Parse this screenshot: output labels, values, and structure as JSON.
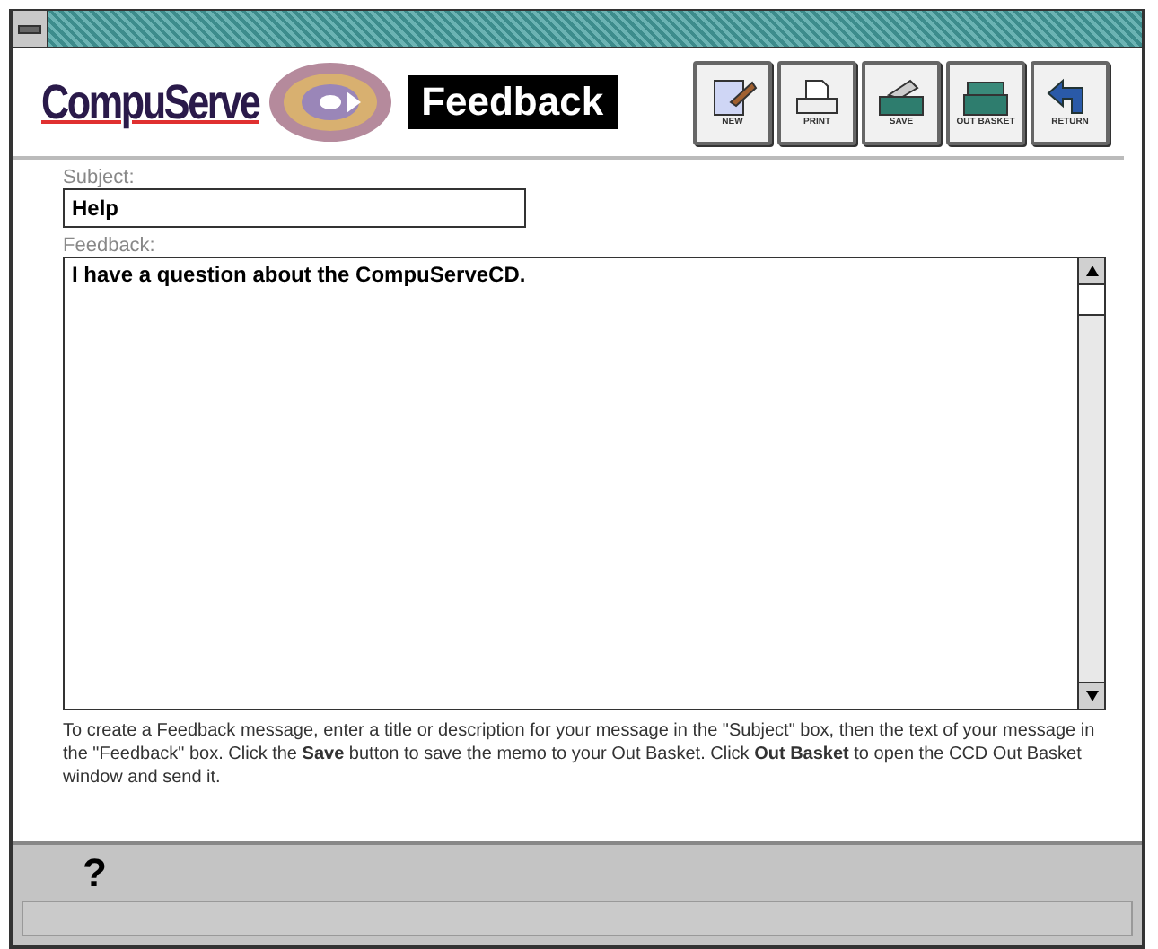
{
  "header": {
    "logo": "CompuServe",
    "title": "Feedback"
  },
  "toolbar": [
    {
      "kind": "new",
      "label": "NEW"
    },
    {
      "kind": "print",
      "label": "PRINT"
    },
    {
      "kind": "save",
      "label": "SAVE"
    },
    {
      "kind": "basket",
      "label": "OUT BASKET"
    },
    {
      "kind": "return",
      "label": "RETURN"
    }
  ],
  "subject": {
    "label": "Subject:",
    "value": "Help"
  },
  "feedback": {
    "label": "Feedback:",
    "value": "I have a question about the CompuServeCD."
  },
  "instructions": "To create a Feedback message, enter a title or description for your message in the \"Subject\" box, then the text of your message in the \"Feedback\" box. Click the **Save** button to save the memo to your Out Basket.  Click **Out Basket** to open the CCD Out Basket window and send it.",
  "status_bar": {
    "help": "?"
  }
}
